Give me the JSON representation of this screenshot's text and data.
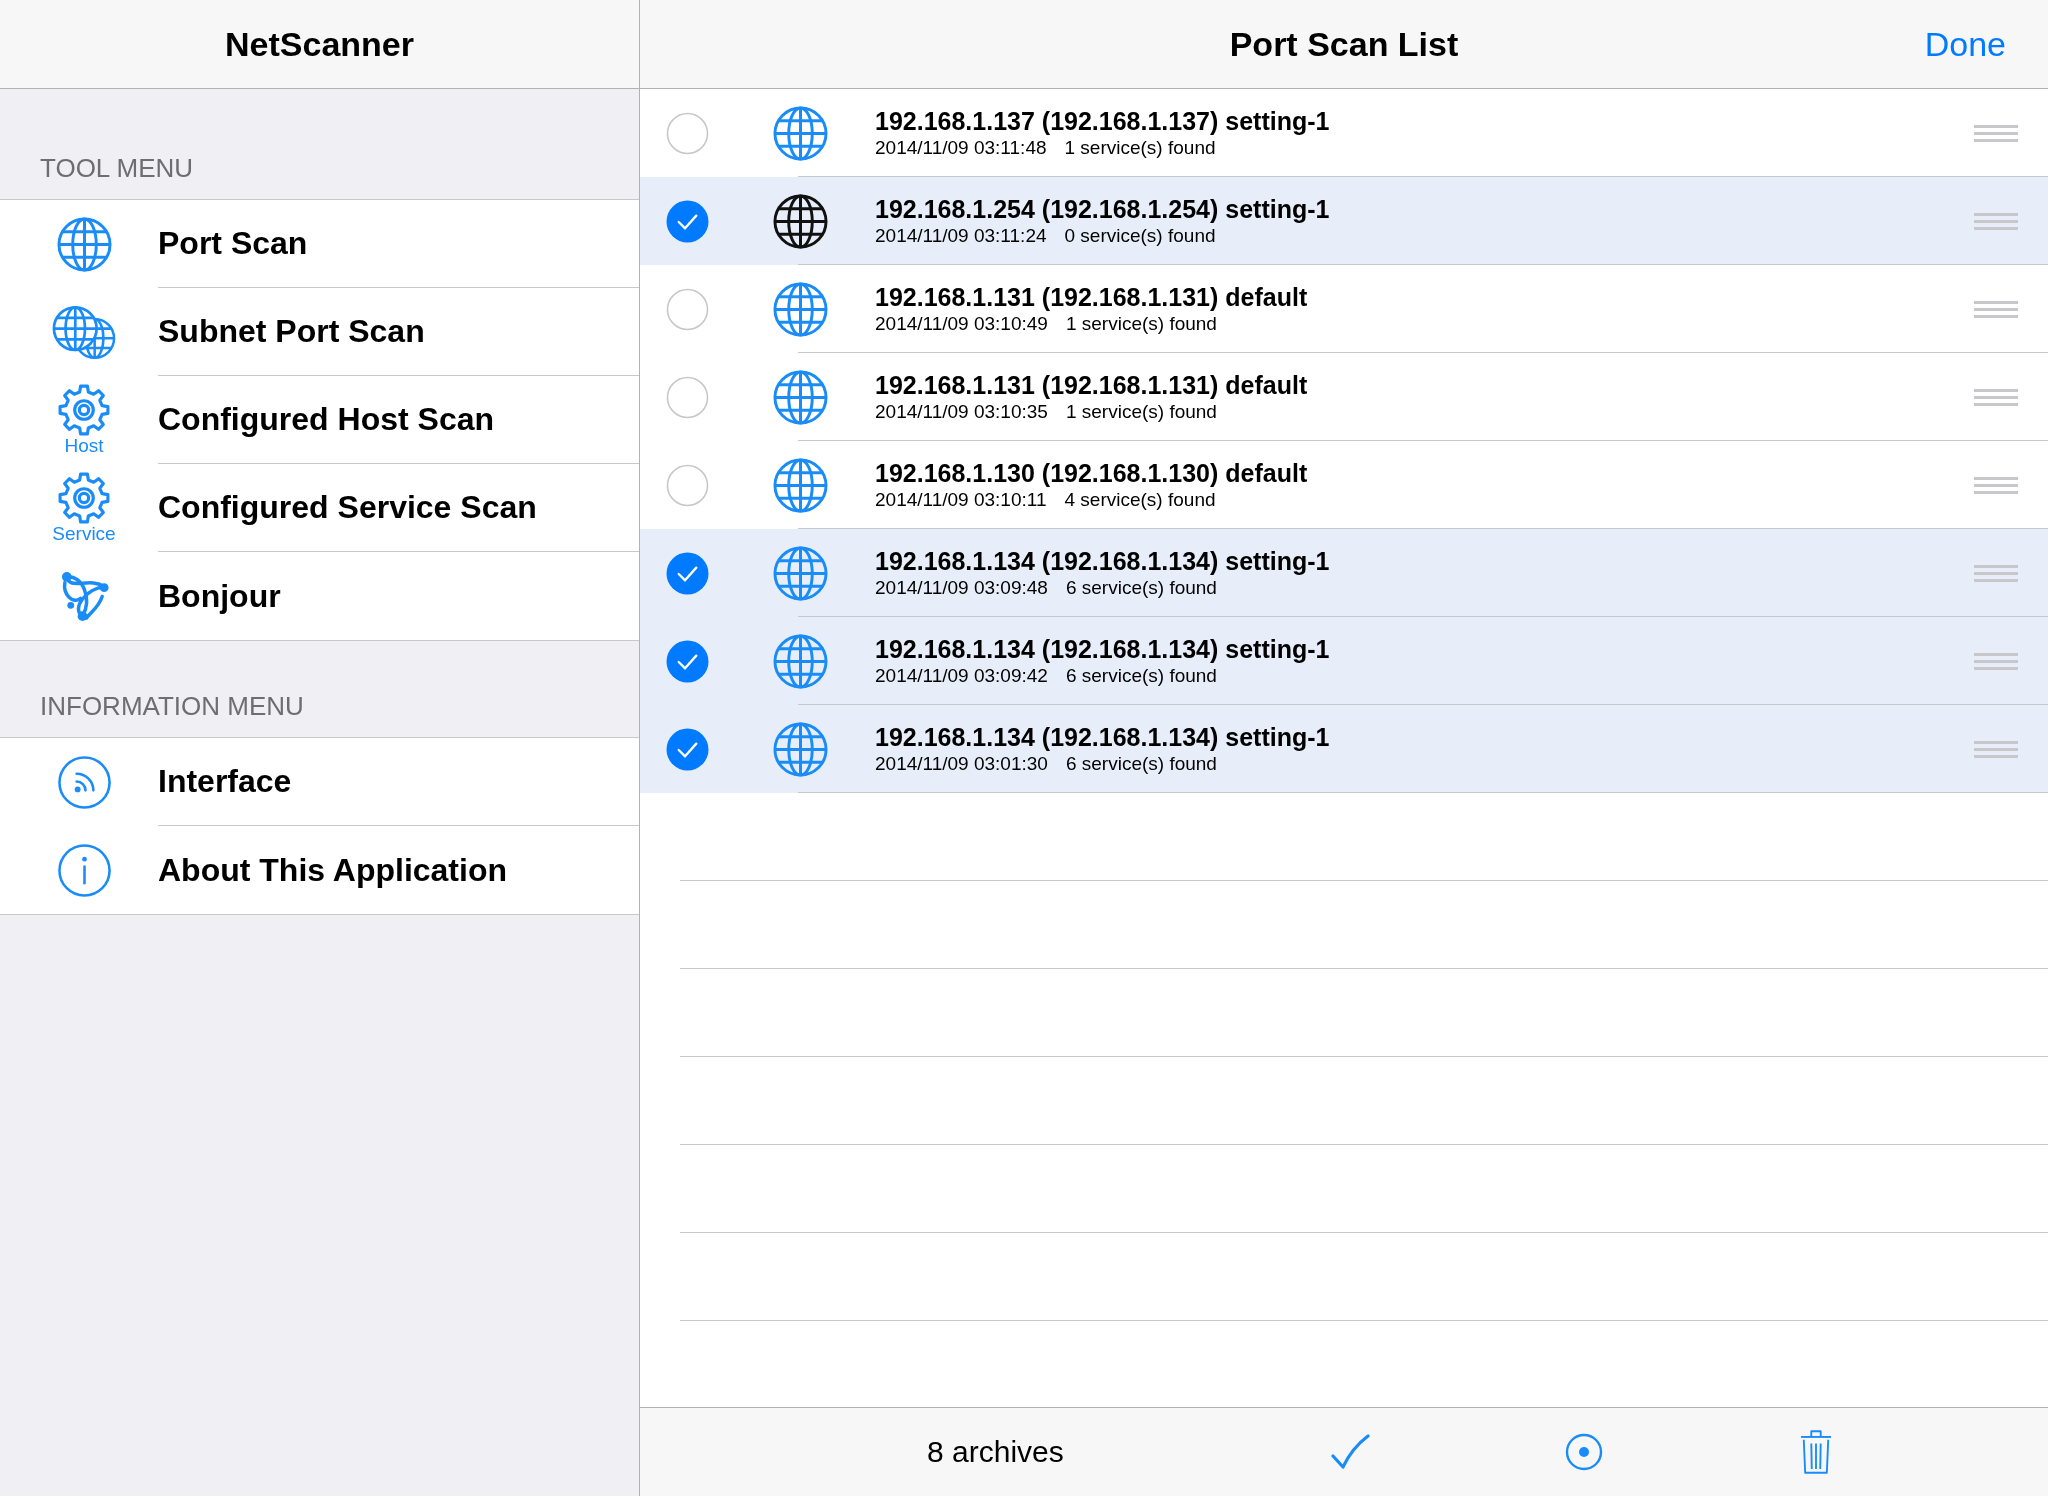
{
  "sidebar": {
    "title": "NetScanner",
    "sections": [
      {
        "header": "TOOL MENU",
        "items": [
          {
            "kind": "globe",
            "label": "Port Scan"
          },
          {
            "kind": "globes",
            "label": "Subnet Port Scan"
          },
          {
            "kind": "gear",
            "icon_caption": "Host",
            "label": "Configured Host Scan"
          },
          {
            "kind": "gear",
            "icon_caption": "Service",
            "label": "Configured Service Scan"
          },
          {
            "kind": "loops",
            "label": "Bonjour"
          }
        ]
      },
      {
        "header": "INFORMATION MENU",
        "items": [
          {
            "kind": "signal",
            "label": "Interface"
          },
          {
            "kind": "info",
            "label": "About This Application"
          }
        ]
      }
    ]
  },
  "scan_list": {
    "title": "Port Scan List",
    "done": "Done",
    "rows": [
      {
        "selected": false,
        "color": "#1a8cf8",
        "title": "192.168.1.137 (192.168.1.137) setting-1",
        "time": "2014/11/09 03:11:48",
        "result": "1 service(s) found"
      },
      {
        "selected": true,
        "color": "#111111",
        "title": "192.168.1.254 (192.168.1.254) setting-1",
        "time": "2014/11/09 03:11:24",
        "result": "0 service(s) found"
      },
      {
        "selected": false,
        "color": "#1a8cf8",
        "title": "192.168.1.131 (192.168.1.131) default",
        "time": "2014/11/09 03:10:49",
        "result": "1 service(s) found"
      },
      {
        "selected": false,
        "color": "#1a8cf8",
        "title": "192.168.1.131 (192.168.1.131) default",
        "time": "2014/11/09 03:10:35",
        "result": "1 service(s) found"
      },
      {
        "selected": false,
        "color": "#1a8cf8",
        "title": "192.168.1.130 (192.168.1.130) default",
        "time": "2014/11/09 03:10:11",
        "result": "4 service(s) found"
      },
      {
        "selected": true,
        "color": "#1a8cf8",
        "title": "192.168.1.134 (192.168.1.134) setting-1",
        "time": "2014/11/09 03:09:48",
        "result": "6 service(s) found"
      },
      {
        "selected": true,
        "color": "#1a8cf8",
        "title": "192.168.1.134 (192.168.1.134) setting-1",
        "time": "2014/11/09 03:09:42",
        "result": "6 service(s) found"
      },
      {
        "selected": true,
        "color": "#1a8cf8",
        "title": "192.168.1.134 (192.168.1.134) setting-1",
        "time": "2014/11/09 03:01:30",
        "result": "6 service(s) found"
      }
    ]
  },
  "toolbar": {
    "count": "8 archives"
  }
}
